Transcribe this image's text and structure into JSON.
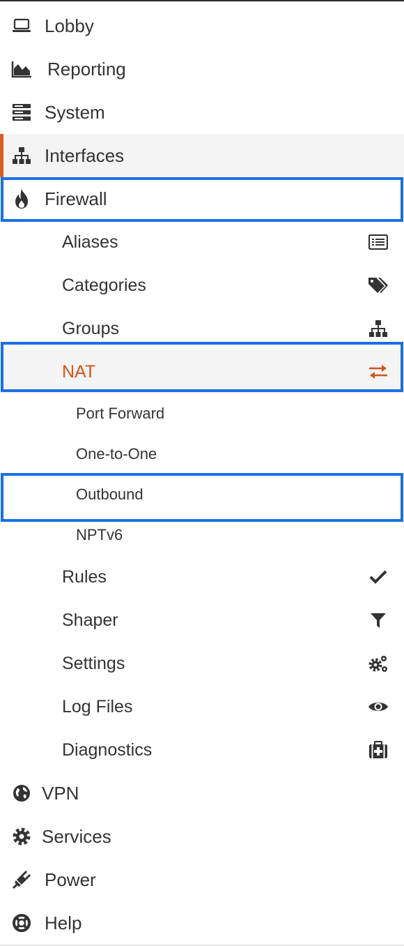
{
  "menu": {
    "top": [
      {
        "label": "Lobby",
        "icon": "laptop-icon"
      },
      {
        "label": "Reporting",
        "icon": "area-chart-icon"
      },
      {
        "label": "System",
        "icon": "server-icon"
      },
      {
        "label": "Interfaces",
        "icon": "sitemap-icon"
      },
      {
        "label": "Firewall",
        "icon": "fire-icon"
      },
      {
        "label": "VPN",
        "icon": "globe-icon"
      },
      {
        "label": "Services",
        "icon": "gear-icon"
      },
      {
        "label": "Power",
        "icon": "plug-icon"
      },
      {
        "label": "Help",
        "icon": "life-ring-icon"
      }
    ],
    "firewall_items": [
      {
        "label": "Aliases",
        "icon": "list-alt-icon"
      },
      {
        "label": "Categories",
        "icon": "tags-icon"
      },
      {
        "label": "Groups",
        "icon": "sitemap-icon"
      },
      {
        "label": "NAT",
        "icon": "exchange-icon"
      },
      {
        "label": "Rules",
        "icon": "check-icon"
      },
      {
        "label": "Shaper",
        "icon": "filter-icon"
      },
      {
        "label": "Settings",
        "icon": "cogs-icon"
      },
      {
        "label": "Log Files",
        "icon": "eye-icon"
      },
      {
        "label": "Diagnostics",
        "icon": "medkit-icon"
      }
    ],
    "nat_items": [
      {
        "label": "Port Forward"
      },
      {
        "label": "One-to-One"
      },
      {
        "label": "Outbound"
      },
      {
        "label": "NPTv6"
      }
    ]
  },
  "colors": {
    "accent": "#e05a1e",
    "nat_text": "#d35418",
    "highlight": "#1a6fe6",
    "active_bg": "#f4f4f4"
  }
}
